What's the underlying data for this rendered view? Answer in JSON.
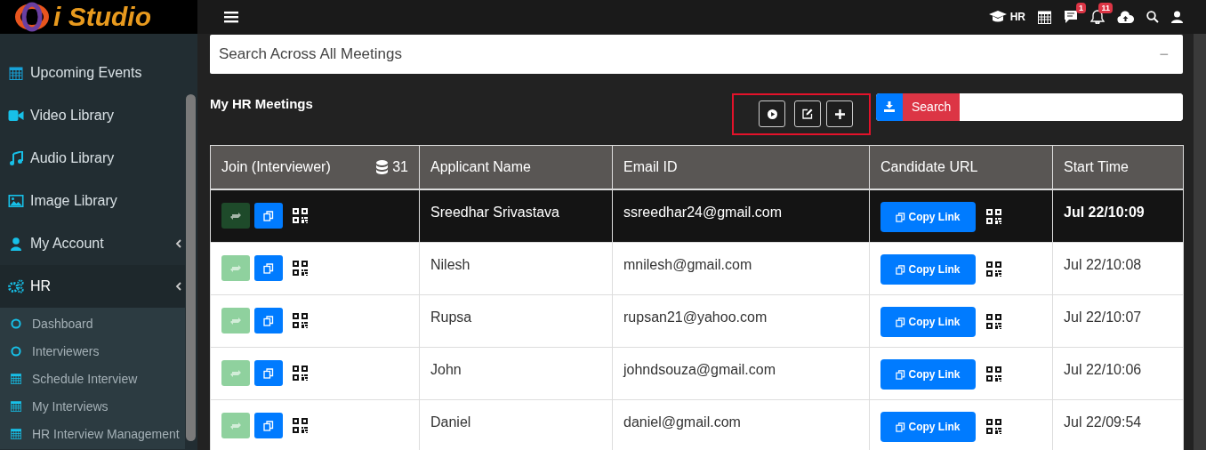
{
  "header": {
    "logo": "i Studio",
    "role": "HR",
    "badges": {
      "messages": "1",
      "notifications": "11"
    }
  },
  "sidebar": {
    "items": [
      {
        "label": "Upcoming Events",
        "expandable": false,
        "selected": false
      },
      {
        "label": "Video Library",
        "expandable": false,
        "selected": false
      },
      {
        "label": "Audio Library",
        "expandable": false,
        "selected": false
      },
      {
        "label": "Image Library",
        "expandable": false,
        "selected": false
      },
      {
        "label": "My Account",
        "expandable": true,
        "selected": false
      },
      {
        "label": "HR",
        "expandable": true,
        "selected": true,
        "children": [
          {
            "label": "Dashboard"
          },
          {
            "label": "Interviewers"
          },
          {
            "label": "Schedule Interview"
          },
          {
            "label": "My Interviews"
          },
          {
            "label": "HR Interview Management"
          }
        ]
      }
    ]
  },
  "search_panel": {
    "title": "Search Across All Meetings",
    "collapse": "−"
  },
  "meetings": {
    "title": "My HR Meetings",
    "search_button": "Search",
    "table": {
      "columns": [
        "Join (Interviewer)",
        "Applicant Name",
        "Email ID",
        "Candidate URL",
        "Start Time"
      ],
      "count": "31",
      "rows": [
        {
          "selected": true,
          "name": "Sreedhar Srivastava",
          "email": "ssreedhar24@gmail.com",
          "link": "Copy Link",
          "time": "Jul 22/10:09"
        },
        {
          "selected": false,
          "name": "Nilesh",
          "email": "mnilesh@gmail.com",
          "link": "Copy Link",
          "time": "Jul 22/10:08"
        },
        {
          "selected": false,
          "name": "Rupsa",
          "email": "rupsan21@yahoo.com",
          "link": "Copy Link",
          "time": "Jul 22/10:07"
        },
        {
          "selected": false,
          "name": "John",
          "email": "johndsouza@gmail.com",
          "link": "Copy Link",
          "time": "Jul 22/10:06"
        },
        {
          "selected": false,
          "name": "Daniel",
          "email": "daniel@gmail.com",
          "link": "Copy Link",
          "time": "Jul 22/09:54"
        }
      ]
    }
  }
}
